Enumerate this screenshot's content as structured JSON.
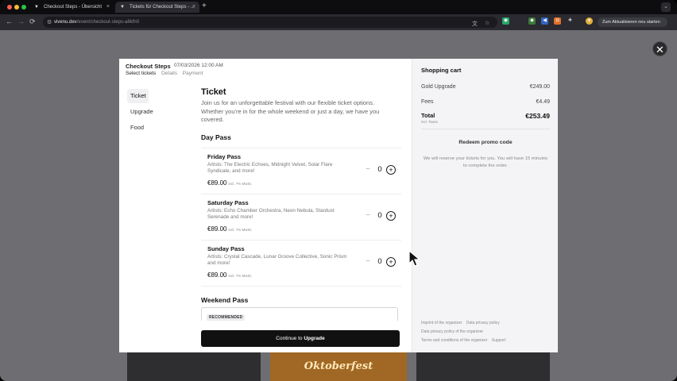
{
  "browser": {
    "tabs": [
      {
        "title": "Checkout Steps - Übersicht",
        "active": false
      },
      {
        "title": "Tickets für Checkout Steps - ...",
        "active": true
      }
    ],
    "new_tab": "+",
    "nav": {
      "back": "←",
      "forward": "→",
      "reload": "⟳"
    },
    "url_host": "vivenu.dev",
    "url_path": "/event/checkout-steps-a8kfn0",
    "update_button": "Zum Aktualisieren neu starten",
    "menu": "⌄"
  },
  "overlay": {
    "close": "✕"
  },
  "background": {
    "fest_text": "Oktoberfest"
  },
  "modal": {
    "title": "Checkout Steps",
    "date": "07/03/2026 12:00 AM",
    "steps": [
      "Select tickets",
      "Details",
      "Payment"
    ],
    "side_nav": [
      "Ticket",
      "Upgrade",
      "Food"
    ],
    "heading": "Ticket",
    "intro": "Join us for an unforgettable festival with our flexible ticket options. Whether you're in for the whole weekend or just a day, we have you covered.",
    "day_pass_heading": "Day Pass",
    "passes": [
      {
        "name": "Friday Pass",
        "artists": "Artists: The Electric Echoes, Midnight Velvet, Solar Flare Syndicate, and more!",
        "price": "€89.00",
        "tax": "incl. 7% MwSt.",
        "qty": "0"
      },
      {
        "name": "Saturday Pass",
        "artists": "Artists: Echo Chamber Orchestra, Neon Nebula, Stardust Serenade and more!",
        "price": "€89.00",
        "tax": "incl. 7% MwSt.",
        "qty": "0"
      },
      {
        "name": "Sunday Pass",
        "artists": "Artists: Crystal Cascade, Lunar Groove Collective, Sonic Prism and more!",
        "price": "€89.00",
        "tax": "incl. 7% MwSt.",
        "qty": "0"
      }
    ],
    "qty_minus": "−",
    "qty_plus": "+",
    "weekend_heading": "Weekend Pass",
    "recommended_badge": "RECOMMENDED",
    "continue_prefix": "Continue to",
    "continue_target": "Upgrade"
  },
  "cart": {
    "title": "Shopping cart",
    "items": [
      {
        "label": "Gold Upgrade",
        "amount": "€249.00"
      },
      {
        "label": "Fees",
        "amount": "€4.49"
      }
    ],
    "total_label": "Total",
    "total_amount": "€253.49",
    "total_sub": "incl. Taxes",
    "promo": "Redeem promo code",
    "reserve_note": "We will reserve your tickets for you. You will have 15 minutes to complete the order.",
    "footer_links": [
      "Imprint of the organizer",
      "Data privacy policy",
      "Data privacy policy of the organizer",
      "Terms and conditions of the organizer",
      "Support"
    ]
  }
}
